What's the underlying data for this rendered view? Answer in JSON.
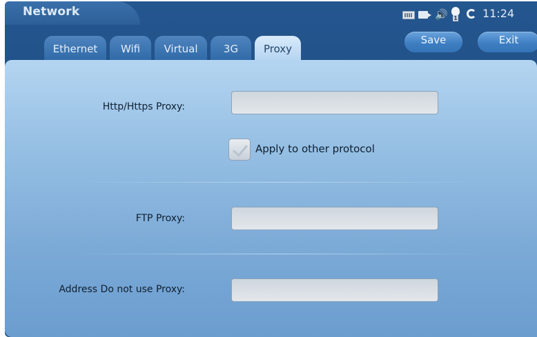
{
  "app": {
    "title": "Network"
  },
  "status_bar": {
    "icons": [
      "keyboard-icon",
      "camera-icon",
      "volume-icon",
      "bulb-icon",
      "sync-icon"
    ],
    "bulb_badge": "1",
    "time": "11:24"
  },
  "header": {
    "save_label": "Save",
    "exit_label": "Exit"
  },
  "tabs": [
    {
      "label": "Ethernet",
      "active": false
    },
    {
      "label": "Wifi",
      "active": false
    },
    {
      "label": "Virtual",
      "active": false
    },
    {
      "label": "3G",
      "active": false
    },
    {
      "label": "Proxy",
      "active": true
    }
  ],
  "form": {
    "http_proxy": {
      "label": "Http/Https Proxy:",
      "value": ""
    },
    "apply_other": {
      "label": "Apply to other protocol",
      "checked": true
    },
    "ftp_proxy": {
      "label": "FTP Proxy:",
      "value": ""
    },
    "no_proxy": {
      "label": "Address Do not use Proxy:",
      "value": ""
    }
  },
  "colors": {
    "frame": "#1e4a7f",
    "panel_top": "#b4d5f1",
    "panel_bottom": "#6b9dcf",
    "button": "#3e7fc3"
  }
}
